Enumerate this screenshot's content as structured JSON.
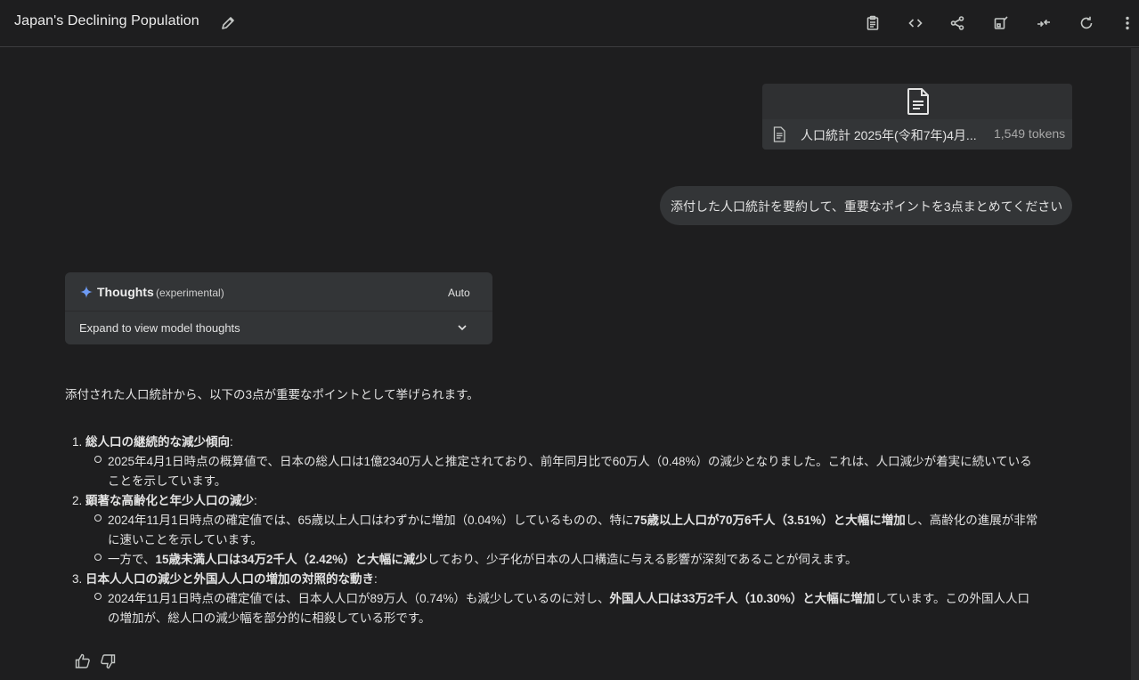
{
  "header": {
    "title": "Japan's Declining Population",
    "icons": [
      "pencil-icon",
      "clipboard-icon",
      "code-icon",
      "share-icon",
      "compare-icon",
      "collapse-icon",
      "refresh-icon",
      "more-vert-icon"
    ]
  },
  "attachment": {
    "file_name": "人口統計 2025年(令和7年)4月...",
    "tokens": "1,549 tokens"
  },
  "user_message": "添付した人口統計を要約して、重要なポイントを3点まとめてください",
  "thoughts": {
    "title": "Thoughts",
    "subtitle": "(experimental)",
    "mode": "Auto",
    "expand_label": "Expand to view model thoughts"
  },
  "answer": {
    "intro": "添付された人口統計から、以下の3点が重要なポイントとして挙げられます。",
    "points": [
      {
        "number": "1.",
        "heading": "総人口の継続的な減少傾向",
        "colon": ":",
        "bullets": [
          {
            "lines": [
              [
                {
                  "t": "2025年4月1日時点の概算値で、日本の総人口は1億2340万人と推定されており、前年同月比で60万人（0.48%）の減少となりました。これは、人口減少が着実に続いている",
                  "b": false
                }
              ],
              [
                {
                  "t": "ことを示しています。",
                  "b": false
                }
              ]
            ]
          }
        ]
      },
      {
        "number": "2.",
        "heading": "顕著な高齢化と年少人口の減少",
        "colon": ":",
        "bullets": [
          {
            "lines": [
              [
                {
                  "t": "2024年11月1日時点の確定値では、65歳以上人口はわずかに増加（0.04%）しているものの、特に",
                  "b": false
                },
                {
                  "t": "75歳以上人口が70万6千人（3.51%）と大幅に増加",
                  "b": true
                },
                {
                  "t": "し、高齢化の進展が非常",
                  "b": false
                }
              ],
              [
                {
                  "t": "に速いことを示しています。",
                  "b": false
                }
              ]
            ]
          },
          {
            "lines": [
              [
                {
                  "t": "一方で、",
                  "b": false
                },
                {
                  "t": "15歳未満人口は34万2千人（2.42%）と大幅に減少",
                  "b": true
                },
                {
                  "t": "しており、少子化が日本の人口構造に与える影響が深刻であることが伺えます。",
                  "b": false
                }
              ]
            ]
          }
        ]
      },
      {
        "number": "3.",
        "heading": "日本人人口の減少と外国人人口の増加の対照的な動き",
        "colon": ":",
        "bullets": [
          {
            "lines": [
              [
                {
                  "t": "2024年11月1日時点の確定値では、日本人人口が89万人（0.74%）も減少しているのに対し、",
                  "b": false
                },
                {
                  "t": "外国人人口は33万2千人（10.30%）と大幅に増加",
                  "b": true
                },
                {
                  "t": "しています。この外国人人口",
                  "b": false
                }
              ],
              [
                {
                  "t": "の増加が、総人口の減少幅を部分的に相殺している形です。",
                  "b": false
                }
              ]
            ]
          }
        ]
      }
    ]
  },
  "feedback": {
    "icons": [
      "thumbs-up-icon",
      "thumbs-down-icon"
    ]
  }
}
